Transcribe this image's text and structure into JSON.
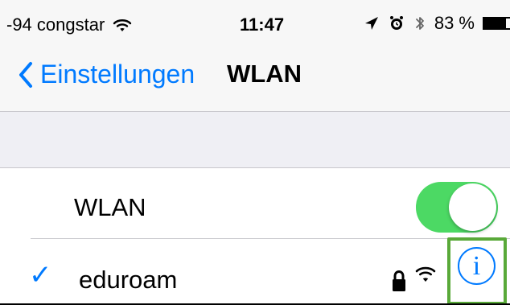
{
  "status_bar": {
    "carrier": "-94 congstar",
    "time": "11:47",
    "battery_percent": "83 %",
    "icons": [
      "wifi-icon",
      "location-icon",
      "alarm-icon",
      "bluetooth-icon",
      "battery-icon"
    ]
  },
  "nav": {
    "back_label": "Einstellungen",
    "title": "WLAN"
  },
  "settings": {
    "wlan_label": "WLAN",
    "wlan_enabled": true,
    "network_name": "eduroam",
    "network_icons": [
      "lock-icon",
      "wifi-signal-icon",
      "info-icon"
    ],
    "checkmark": "✓",
    "info_glyph": "i"
  },
  "colors": {
    "accent": "#007aff",
    "toggle_on": "#4cd964",
    "highlight": "#59a939"
  }
}
